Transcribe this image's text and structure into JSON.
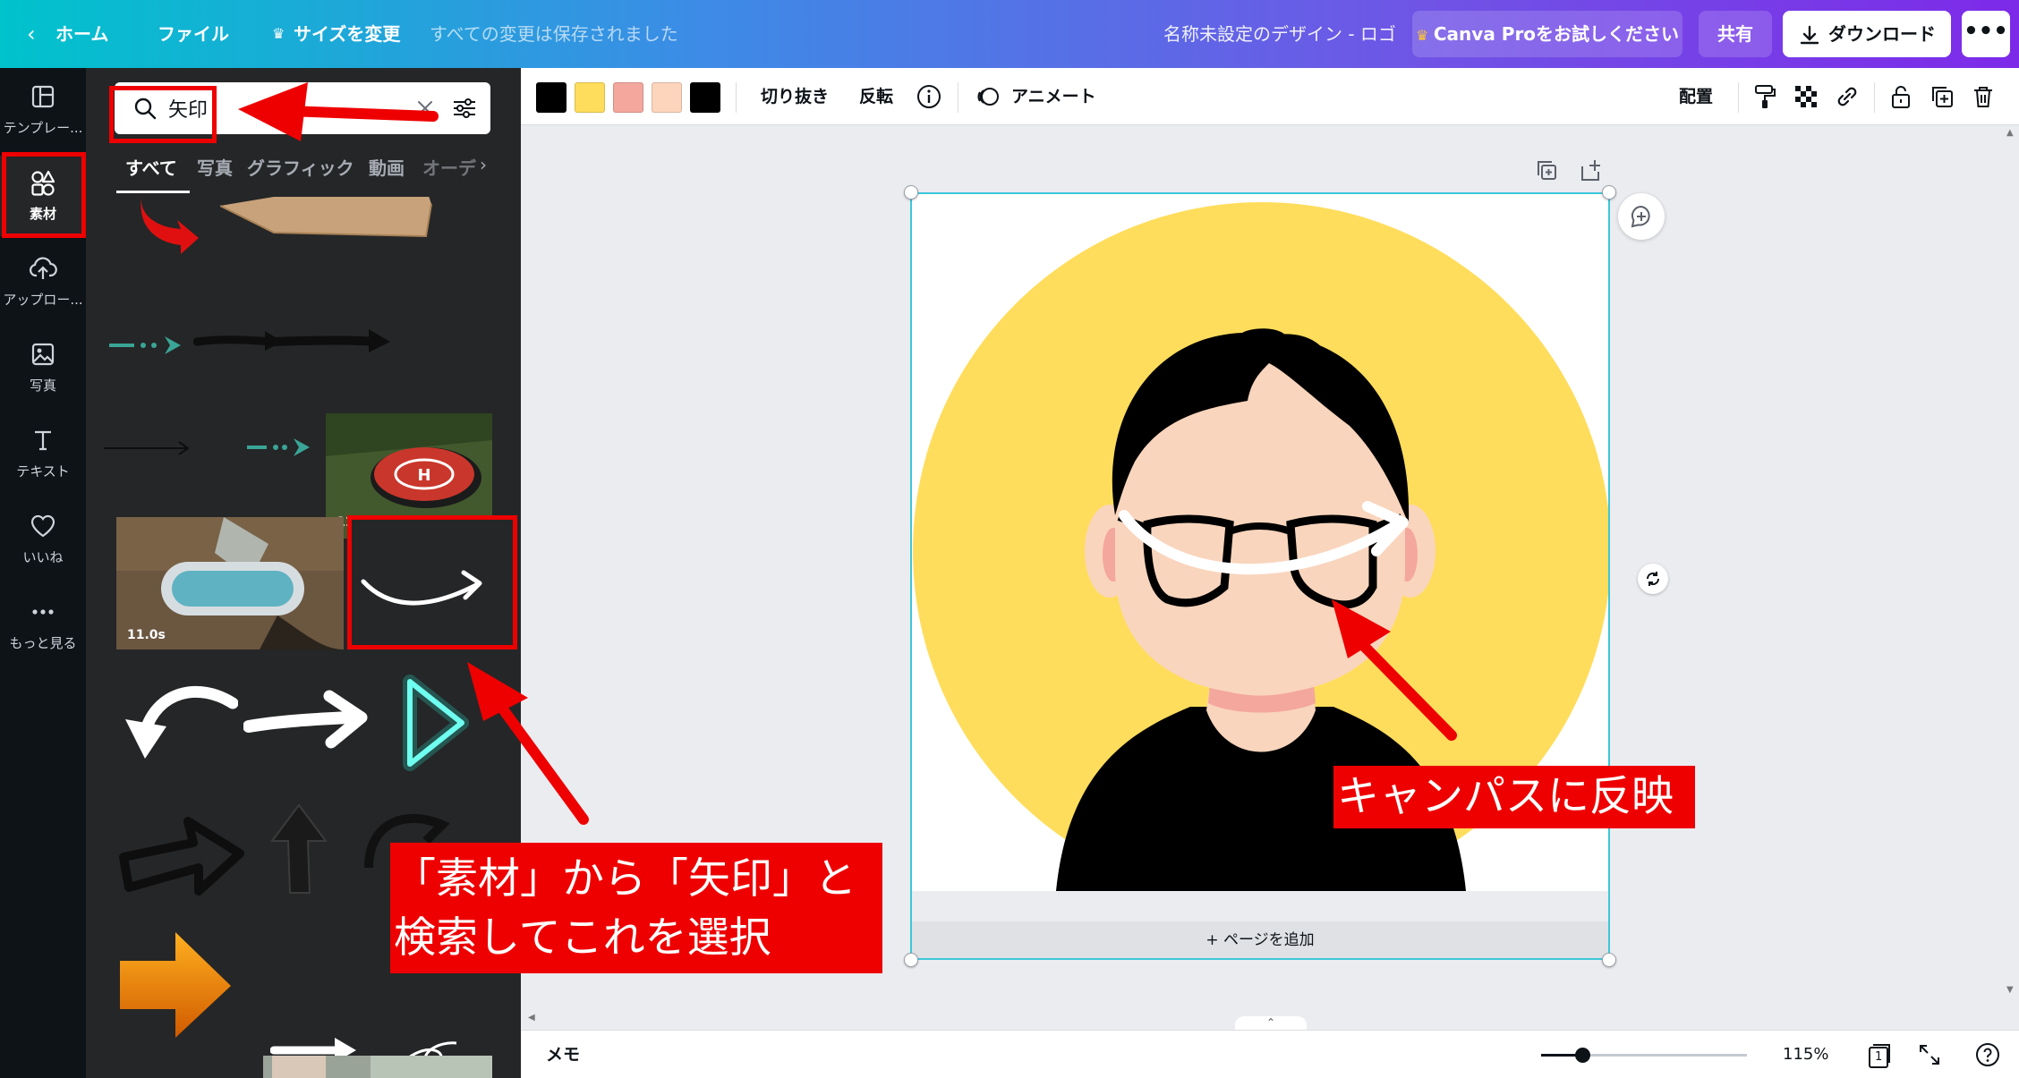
{
  "topbar": {
    "home": "ホーム",
    "file": "ファイル",
    "resize": "サイズを変更",
    "saved_status": "すべての変更は保存されました",
    "design_title": "名称未設定のデザイン - ロゴ",
    "pro_button": "Canva Proをお試しください",
    "share_button": "共有",
    "download_button": "ダウンロード",
    "more_button": "•••"
  },
  "rail": {
    "items": [
      {
        "label": "テンプレー...",
        "icon": "template-icon"
      },
      {
        "label": "素材",
        "icon": "elements-icon",
        "active": true
      },
      {
        "label": "アップロー...",
        "icon": "upload-icon"
      },
      {
        "label": "写真",
        "icon": "photo-icon"
      },
      {
        "label": "テキスト",
        "icon": "text-icon"
      },
      {
        "label": "いいね",
        "icon": "heart-icon"
      },
      {
        "label": "もっと見る",
        "icon": "more-dots-icon"
      }
    ]
  },
  "panel": {
    "search_value": "矢印",
    "tabs": [
      "すべて",
      "写真",
      "グラフィック",
      "動画",
      "オーデ"
    ],
    "video_duration_1": "11.0s",
    "video_duration_2": "11.0s"
  },
  "toolbar": {
    "colors": [
      "#000000",
      "#ffdd5c",
      "#f4a79d",
      "#fdd5bd",
      "#000000"
    ],
    "crop": "切り抜き",
    "flip": "反転",
    "animate": "アニメート",
    "position": "配置"
  },
  "canvas": {
    "add_page": "+ ページを追加",
    "accent_color": "#3ec6d8"
  },
  "bottombar": {
    "memo": "メモ",
    "zoom": "115%",
    "zoom_fraction": 0.2,
    "page_count": "1"
  },
  "annotations": {
    "reflect_label": "キャンパスに反映",
    "search_label_line1": "「素材」から「矢印」と",
    "search_label_line2": "検索してこれを選択",
    "color": "#ee0000"
  }
}
